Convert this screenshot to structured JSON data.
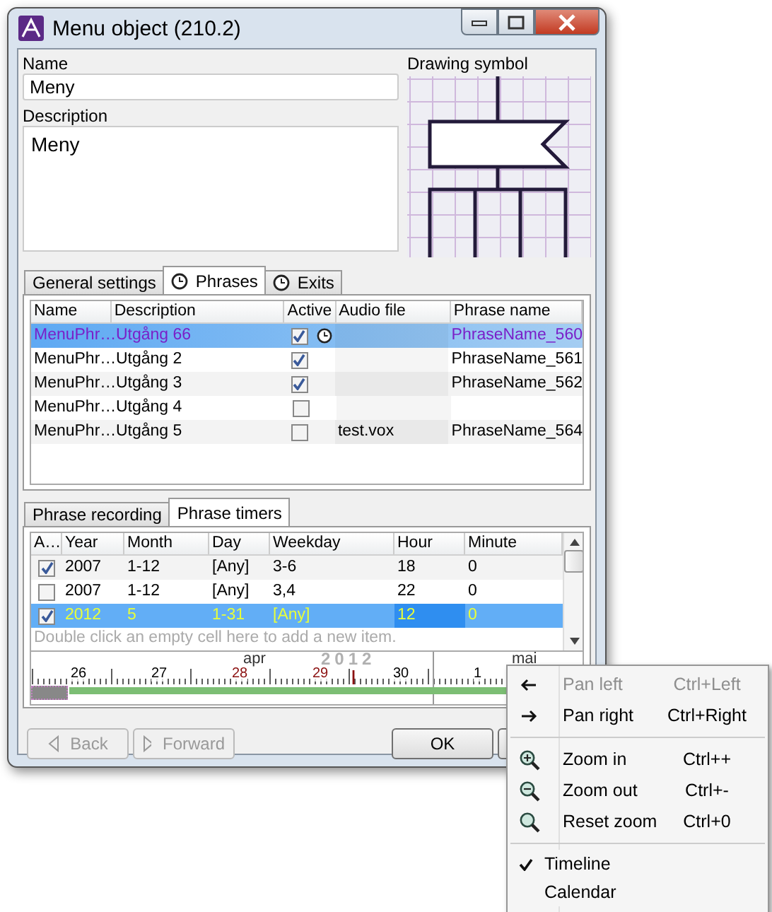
{
  "window": {
    "title": "Menu object (210.2)"
  },
  "name_field": {
    "label": "Name",
    "value": "Meny"
  },
  "description_field": {
    "label": "Description",
    "value": "Meny"
  },
  "drawing_symbol": {
    "label": "Drawing symbol"
  },
  "tabs": [
    {
      "label": "General settings",
      "selected": false,
      "kind": "plain"
    },
    {
      "label": "Phrases",
      "selected": true,
      "kind": "clock"
    },
    {
      "label": "Exits",
      "selected": false,
      "kind": "clock"
    }
  ],
  "phrases_table": {
    "columns": [
      "Name",
      "Description",
      "Active",
      "Audio file",
      "Phrase name"
    ],
    "rows": [
      {
        "name": "MenuPhr…",
        "description": "Utgång 66",
        "active": true,
        "timer": true,
        "phrase_name": "PhraseName_560",
        "selected": true
      },
      {
        "name": "MenuPhr…",
        "description": "Utgång 2",
        "active": true,
        "timer": false,
        "phrase_name": "PhraseName_561",
        "selected": false
      },
      {
        "name": "MenuPhr…",
        "description": "Utgång 3",
        "active": true,
        "timer": false,
        "phrase_name": "PhraseName_562",
        "selected": false
      },
      {
        "name": "MenuPhr…",
        "description": "Utgång 4",
        "active": false,
        "timer": false,
        "selected": false
      },
      {
        "name": "MenuPhr…",
        "description": "Utgång 5",
        "active": false,
        "timer": false,
        "audio_file": "test.vox",
        "phrase_name": "PhraseName_564",
        "selected": false
      }
    ]
  },
  "timer_tabs": [
    {
      "label": "Phrase recording",
      "selected": false
    },
    {
      "label": "Phrase timers",
      "selected": true
    }
  ],
  "timers_table": {
    "checkbox_column": "A…",
    "columns": [
      "Year",
      "Month",
      "Day",
      "Weekday",
      "Hour",
      "Minute"
    ],
    "rows": [
      {
        "checked": true,
        "cells": [
          "2007",
          "1-12",
          "[Any]",
          "3-6",
          "18",
          "0"
        ],
        "selected": false
      },
      {
        "checked": false,
        "cells": [
          "2007",
          "1-12",
          "[Any]",
          "3,4",
          "22",
          "0"
        ],
        "selected": false
      },
      {
        "checked": true,
        "cells": [
          "2012",
          "5",
          "1-31",
          "[Any]",
          "12",
          "0"
        ],
        "selected": true
      }
    ],
    "hint": "Double click an empty cell here to add a new item."
  },
  "timeline": {
    "year": "2012",
    "months": [
      "apr",
      "mai"
    ],
    "days": [
      {
        "label": "26",
        "weekend": false
      },
      {
        "label": "27",
        "weekend": false
      },
      {
        "label": "28",
        "weekend": true
      },
      {
        "label": "29",
        "weekend": true
      },
      {
        "label": "30",
        "weekend": false
      },
      {
        "label": "1",
        "weekend": false
      }
    ]
  },
  "buttons": [
    {
      "label": "Back",
      "disabled": true,
      "kind": "back"
    },
    {
      "label": "Forward",
      "disabled": true,
      "kind": "forward"
    },
    {
      "label": "OK",
      "disabled": false,
      "kind": "plain"
    }
  ],
  "context_menu": {
    "sections": [
      {
        "items": [
          {
            "label": "Pan left",
            "shortcut": "Ctrl+Left",
            "disabled": true
          },
          {
            "label": "Pan right",
            "shortcut": "Ctrl+Right",
            "disabled": false
          }
        ]
      },
      {
        "items": [
          {
            "label": "Zoom in",
            "shortcut": "Ctrl++",
            "disabled": false
          },
          {
            "label": "Zoom out",
            "shortcut": "Ctrl+-",
            "disabled": false
          },
          {
            "label": "Reset zoom",
            "shortcut": "Ctrl+0",
            "disabled": false
          }
        ]
      },
      {
        "items": [
          {
            "label": "Timeline",
            "checked": true
          },
          {
            "label": "Calendar",
            "checked": false
          }
        ]
      }
    ]
  }
}
